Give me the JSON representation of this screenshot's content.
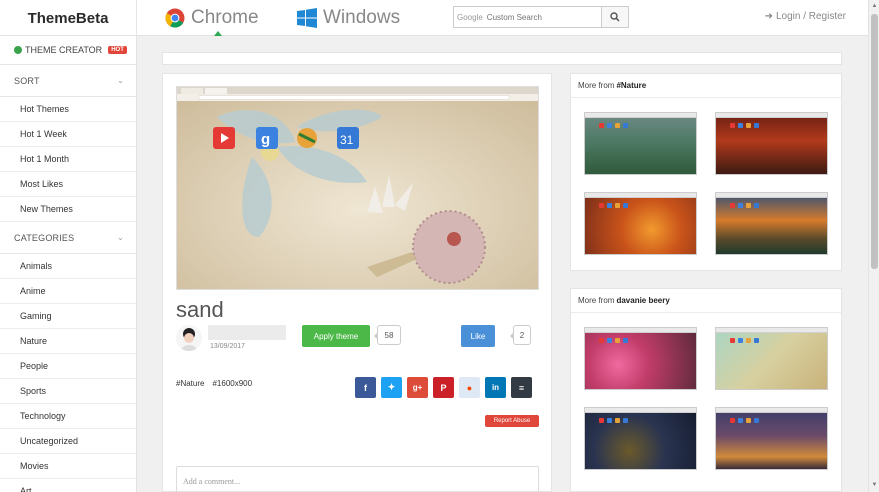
{
  "header": {
    "logo": "ThemeBeta",
    "tabs": [
      {
        "label": "Chrome",
        "active": true
      },
      {
        "label": "Windows",
        "active": false
      }
    ],
    "search": {
      "brand": "Google",
      "placeholder": "Custom Search"
    },
    "login_label": "Login / Register"
  },
  "sidebar": {
    "creator": {
      "label": "THEME CREATOR",
      "badge": "HOT"
    },
    "sort": {
      "title": "SORT",
      "items": [
        "Hot Themes",
        "Hot 1 Week",
        "Hot 1 Month",
        "Most Likes",
        "New Themes"
      ]
    },
    "categories": {
      "title": "CATEGORIES",
      "items": [
        "Animals",
        "Anime",
        "Gaming",
        "Nature",
        "People",
        "Sports",
        "Technology",
        "Uncategorized",
        "Movies",
        "Art"
      ]
    }
  },
  "theme": {
    "preview_apps": [
      "YouTube",
      "Google",
      "Chrome",
      "Calendar"
    ],
    "title": "sand",
    "date": "13/09/2017",
    "apply_label": "Apply theme",
    "apply_count": "58",
    "like_label": "Like",
    "like_count": "2",
    "tags": [
      "#Nature",
      "#1600x900"
    ],
    "share_icons": [
      "facebook",
      "twitter",
      "google-plus",
      "pinterest",
      "reddit",
      "linkedin",
      "buffer"
    ],
    "report_label": "Report Abuse",
    "comment_placeholder": "Add a comment..."
  },
  "more_panels": [
    {
      "prefix": "More from ",
      "source": "#Nature"
    },
    {
      "prefix": "More from ",
      "source": "davanie beery"
    }
  ],
  "colors": {
    "accent_green": "#4cb848",
    "like_blue": "#4a90d9",
    "hot_red": "#e0463a"
  }
}
